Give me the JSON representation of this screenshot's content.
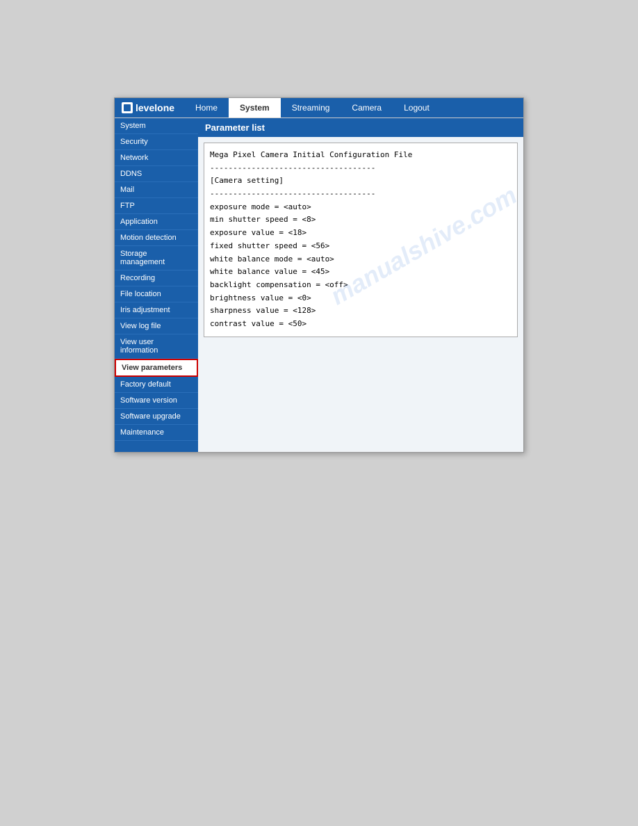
{
  "app": {
    "logo_text": "levelone",
    "logo_icon": "network-icon"
  },
  "nav": {
    "tabs": [
      {
        "label": "Home",
        "active": false
      },
      {
        "label": "System",
        "active": true
      },
      {
        "label": "Streaming",
        "active": false
      },
      {
        "label": "Camera",
        "active": false
      },
      {
        "label": "Logout",
        "active": false
      }
    ]
  },
  "sidebar": {
    "items": [
      {
        "label": "System",
        "highlighted": false
      },
      {
        "label": "Security",
        "highlighted": false
      },
      {
        "label": "Network",
        "highlighted": false
      },
      {
        "label": "DDNS",
        "highlighted": false
      },
      {
        "label": "Mail",
        "highlighted": false
      },
      {
        "label": "FTP",
        "highlighted": false
      },
      {
        "label": "Application",
        "highlighted": false
      },
      {
        "label": "Motion detection",
        "highlighted": false
      },
      {
        "label": "Storage management",
        "highlighted": false
      },
      {
        "label": "Recording",
        "highlighted": false
      },
      {
        "label": "File location",
        "highlighted": false
      },
      {
        "label": "Iris adjustment",
        "highlighted": false
      },
      {
        "label": "View log file",
        "highlighted": false
      },
      {
        "label": "View user information",
        "highlighted": false
      },
      {
        "label": "View parameters",
        "highlighted": true
      },
      {
        "label": "Factory default",
        "highlighted": false
      },
      {
        "label": "Software version",
        "highlighted": false
      },
      {
        "label": "Software upgrade",
        "highlighted": false
      },
      {
        "label": "Maintenance",
        "highlighted": false
      }
    ]
  },
  "panel": {
    "title": "Parameter list"
  },
  "parameters": {
    "lines": [
      "Mega Pixel Camera Initial Configuration File",
      "------------------------------------",
      "[Camera setting]",
      "------------------------------------",
      "exposure mode = <auto>",
      "min shutter speed = <8>",
      "exposure value = <18>",
      "fixed shutter speed = <56>",
      "white balance mode = <auto>",
      "white balance value = <45>",
      "backlight compensation = <off>",
      "brightness value = <0>",
      "sharpness value = <128>",
      "contrast value = <50>"
    ]
  },
  "watermark": "manualshive.com"
}
